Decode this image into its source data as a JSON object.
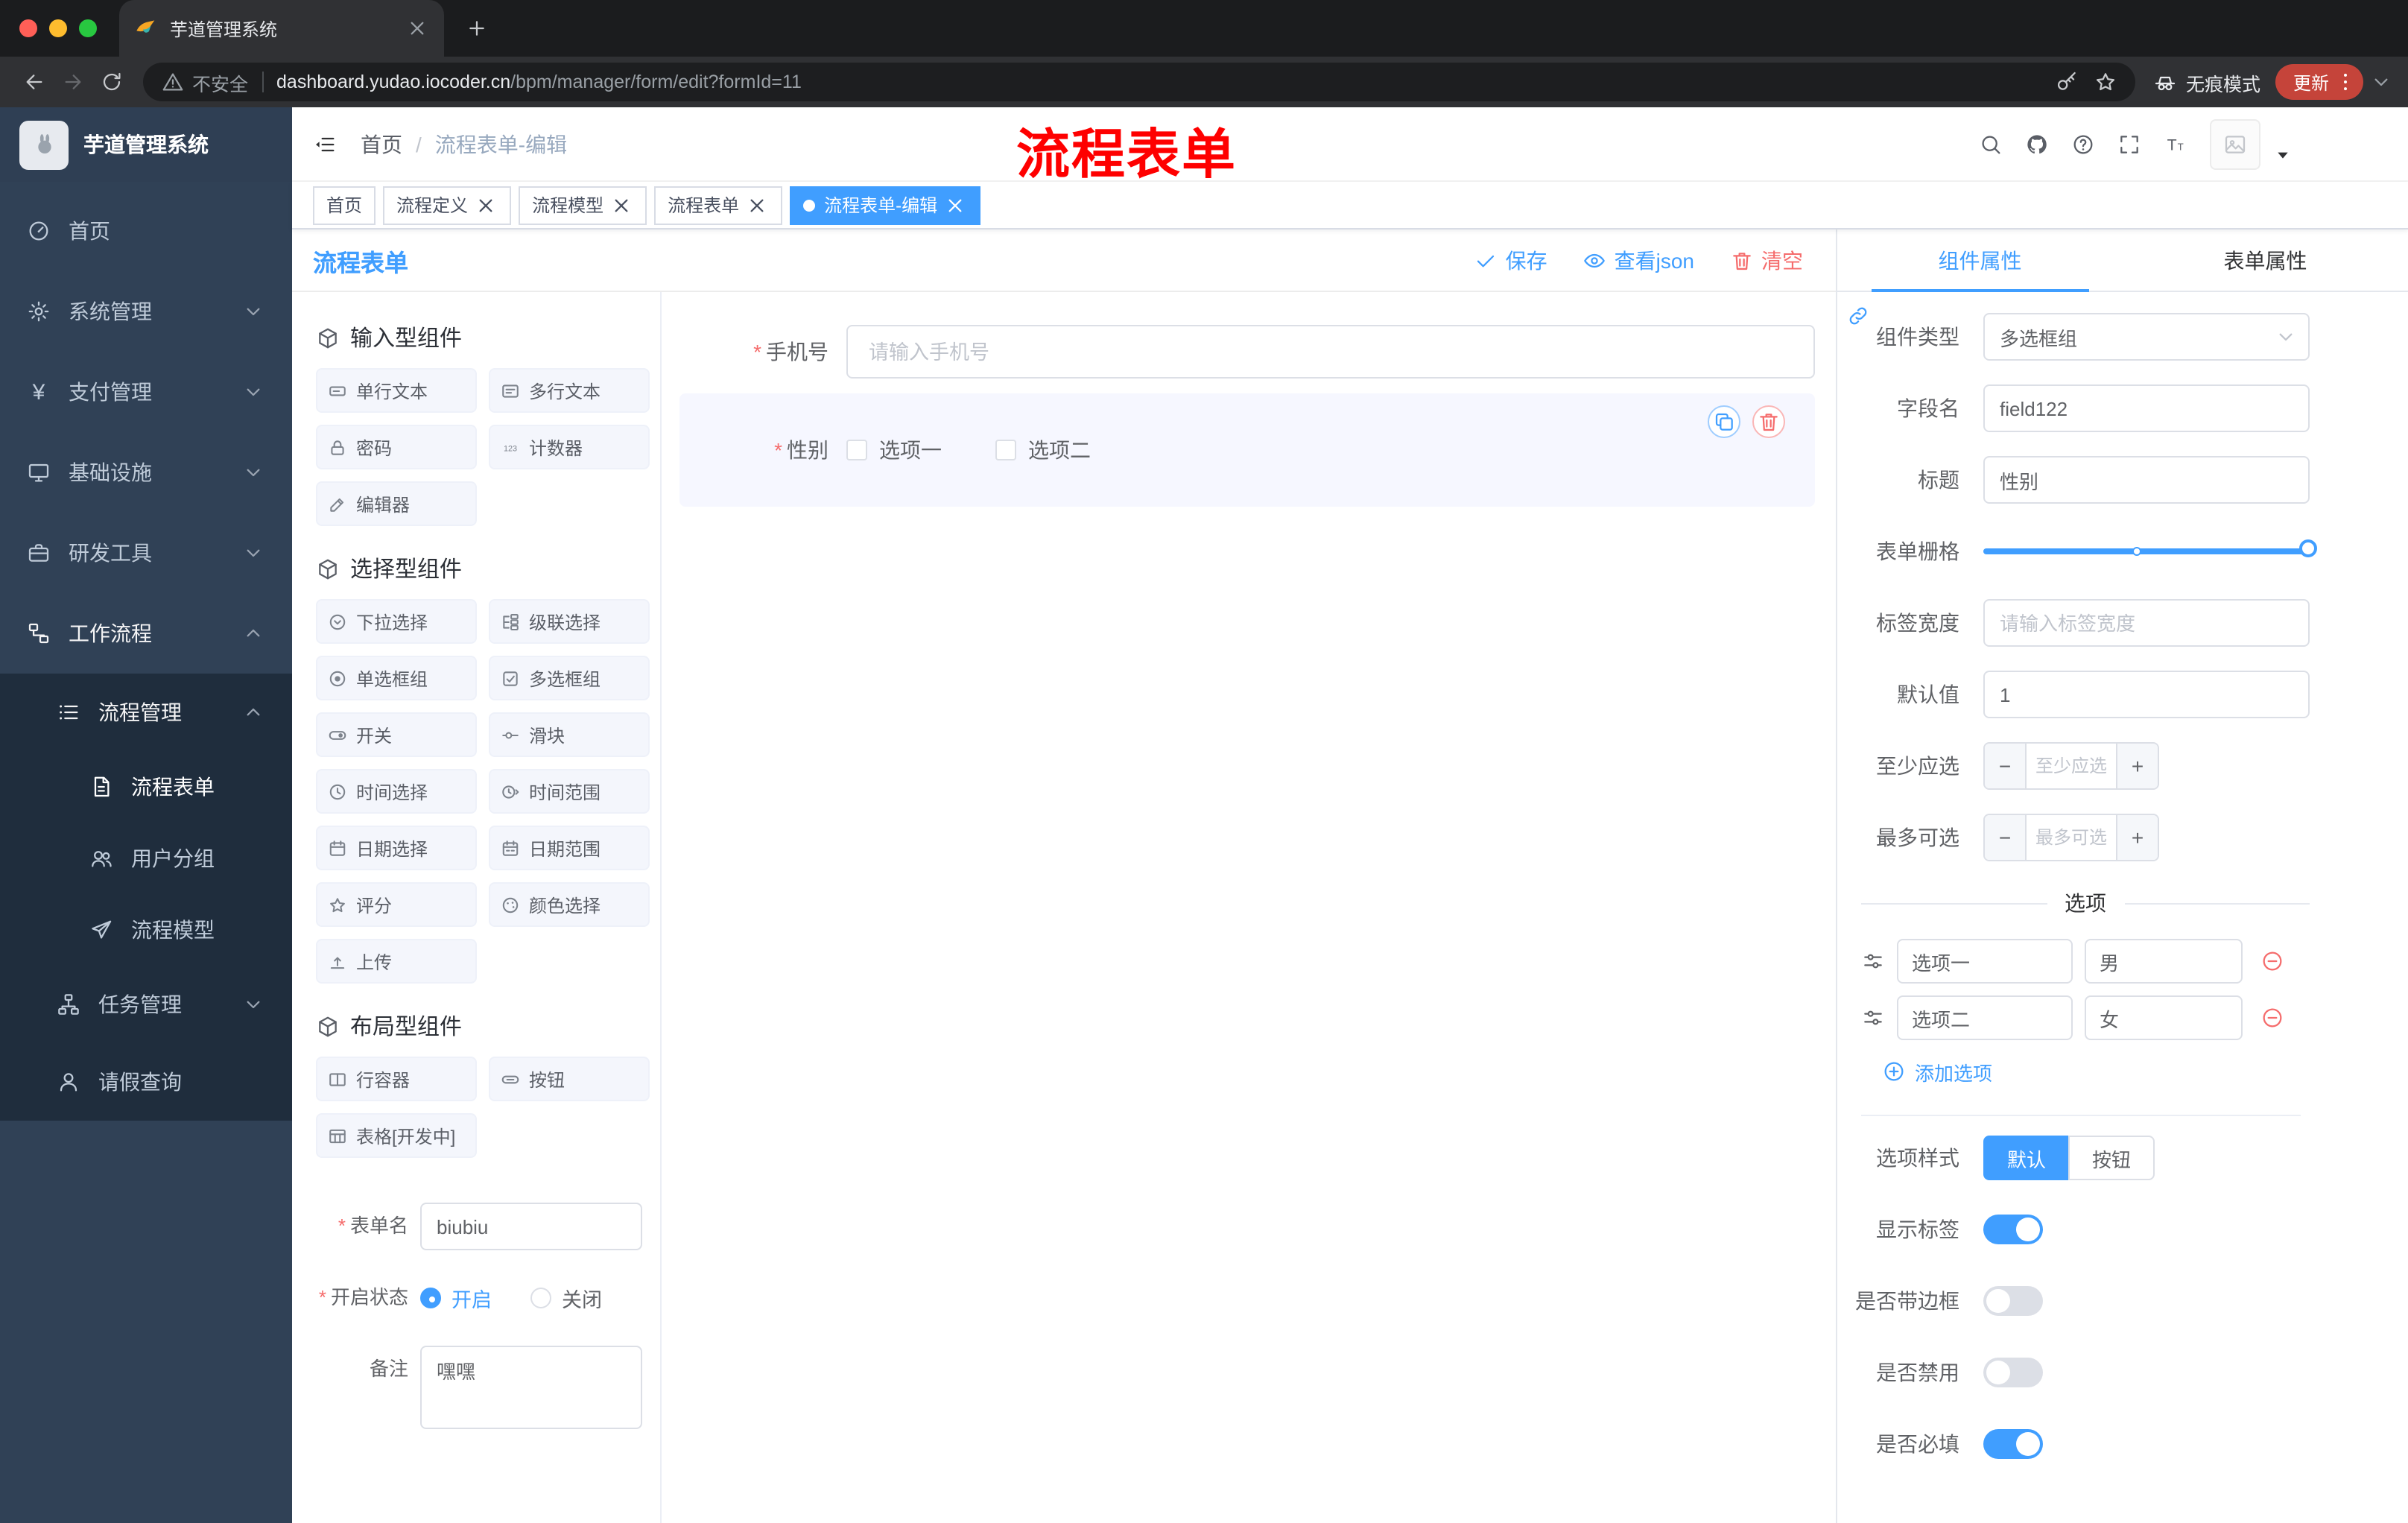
{
  "browser": {
    "tab": {
      "title": "芋道管理系统"
    },
    "address": {
      "security_label": "不安全",
      "url_host": "dashboard.yudao.iocoder.cn",
      "url_path": "/bpm/manager/form/edit?formId=11",
      "incognito_label": "无痕模式",
      "update_label": "更新"
    }
  },
  "sidebar": {
    "logo_title": "芋道管理系统",
    "menu": [
      {
        "label": "首页"
      },
      {
        "label": "系统管理"
      },
      {
        "label": "支付管理"
      },
      {
        "label": "基础设施"
      },
      {
        "label": "研发工具"
      },
      {
        "label": "工作流程"
      }
    ],
    "submenu": [
      {
        "label": "流程管理"
      },
      {
        "label": "流程表单"
      },
      {
        "label": "用户分组"
      },
      {
        "label": "流程模型"
      },
      {
        "label": "任务管理"
      },
      {
        "label": "请假查询"
      }
    ]
  },
  "header": {
    "breadcrumb_home": "首页",
    "breadcrumb_separator": "/",
    "breadcrumb_current": "流程表单-编辑",
    "annotation": "流程表单"
  },
  "tags": [
    {
      "label": "首页"
    },
    {
      "label": "流程定义"
    },
    {
      "label": "流程模型"
    },
    {
      "label": "流程表单"
    },
    {
      "label": "流程表单-编辑"
    }
  ],
  "designer": {
    "title": "流程表单",
    "actions": {
      "save": "保存",
      "view_json": "查看json",
      "clear": "清空"
    }
  },
  "palette": {
    "groups": [
      {
        "title": "输入型组件",
        "items": [
          {
            "label": "单行文本",
            "icon": "single-line-text-icon"
          },
          {
            "label": "多行文本",
            "icon": "multi-line-text-icon"
          },
          {
            "label": "密码",
            "icon": "password-lock-icon"
          },
          {
            "label": "计数器",
            "icon": "counter-123-icon"
          },
          {
            "label": "编辑器",
            "icon": "editor-pen-icon"
          }
        ]
      },
      {
        "title": "选择型组件",
        "items": [
          {
            "label": "下拉选择",
            "icon": "select-dropdown-icon"
          },
          {
            "label": "级联选择",
            "icon": "cascader-icon"
          },
          {
            "label": "单选框组",
            "icon": "radio-group-icon"
          },
          {
            "label": "多选框组",
            "icon": "checkbox-group-icon"
          },
          {
            "label": "开关",
            "icon": "switch-icon"
          },
          {
            "label": "滑块",
            "icon": "slider-icon"
          },
          {
            "label": "时间选择",
            "icon": "time-picker-icon"
          },
          {
            "label": "时间范围",
            "icon": "time-range-icon"
          },
          {
            "label": "日期选择",
            "icon": "date-picker-icon"
          },
          {
            "label": "日期范围",
            "icon": "date-range-icon"
          },
          {
            "label": "评分",
            "icon": "rate-star-icon"
          },
          {
            "label": "颜色选择",
            "icon": "color-picker-icon"
          },
          {
            "label": "上传",
            "icon": "upload-icon"
          }
        ]
      },
      {
        "title": "布局型组件",
        "items": [
          {
            "label": "行容器",
            "icon": "row-container-icon"
          },
          {
            "label": "按钮",
            "icon": "button-icon"
          },
          {
            "label": "表格[开发中]",
            "icon": "table-icon"
          }
        ]
      }
    ]
  },
  "meta_form": {
    "form_name": {
      "label": "表单名",
      "value": "biubiu"
    },
    "status": {
      "label": "开启状态",
      "options": [
        "开启",
        "关闭"
      ],
      "selected": "开启"
    },
    "remark": {
      "label": "备注",
      "value": "嘿嘿"
    }
  },
  "canvas": {
    "phone": {
      "label": "手机号",
      "placeholder": "请输入手机号"
    },
    "gender": {
      "label": "性别",
      "options": [
        "选项一",
        "选项二"
      ]
    }
  },
  "props": {
    "tabs": {
      "component": "组件属性",
      "form": "表单属性"
    },
    "component_type": {
      "label": "组件类型",
      "value": "多选框组"
    },
    "field_name": {
      "label": "字段名",
      "value": "field122"
    },
    "title": {
      "label": "标题",
      "value": "性别"
    },
    "grid": {
      "label": "表单栅格"
    },
    "label_width": {
      "label": "标签宽度",
      "placeholder": "请输入标签宽度"
    },
    "default_value": {
      "label": "默认值",
      "value": "1"
    },
    "min_select": {
      "label": "至少应选",
      "placeholder": "至少应选"
    },
    "max_select": {
      "label": "最多可选",
      "placeholder": "最多可选"
    },
    "options": {
      "title": "选项",
      "rows": [
        {
          "label": "选项一",
          "value": "男"
        },
        {
          "label": "选项二",
          "value": "女"
        }
      ],
      "add_label": "添加选项"
    },
    "style": {
      "label": "选项样式",
      "choices": [
        "默认",
        "按钮"
      ],
      "selected": "默认"
    },
    "switches": [
      {
        "label": "显示标签",
        "on": true
      },
      {
        "label": "是否带边框",
        "on": false
      },
      {
        "label": "是否禁用",
        "on": false
      },
      {
        "label": "是否必填",
        "on": true
      }
    ]
  },
  "colors": {
    "accent": "#409EFF",
    "danger": "#F56C6C",
    "annotation_red": "#FE0000",
    "sidebar_bg": "#304156",
    "submenu_bg": "#1F2D3D",
    "tag_active": "#409EFF"
  },
  "icons": {
    "note": "semantic icon names used in markup",
    "list": [
      "search-icon",
      "github-icon",
      "help-icon",
      "fullscreen-icon",
      "font-size-icon",
      "avatar-image-icon",
      "fold-menu-icon",
      "save-check-icon",
      "view-json-eye-icon",
      "clear-trash-icon",
      "copy-icon",
      "delete-icon",
      "link-icon",
      "drag-handle-icon",
      "remove-option-icon",
      "add-option-icon",
      "back-icon",
      "forward-icon",
      "reload-icon",
      "warning-icon",
      "key-icon",
      "bookmark-star-icon",
      "incognito-icon",
      "more-vertical-icon",
      "close-icon",
      "new-tab-plus-icon"
    ]
  }
}
